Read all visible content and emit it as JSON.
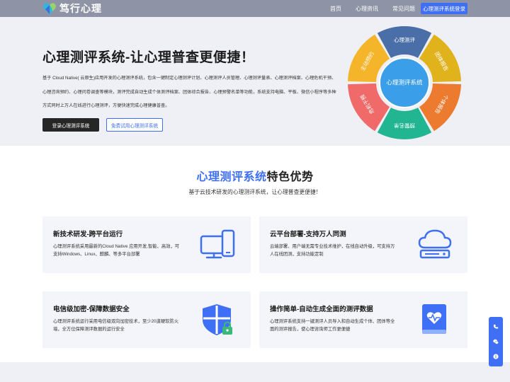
{
  "nav": {
    "brand": "笃行心理",
    "links": [
      "首页",
      "心理资讯",
      "常见问题"
    ],
    "login_button": "心理测评系统登录"
  },
  "hero": {
    "title": "心理测评系统-让心理普查更便捷！",
    "description": "基于 Cloud Native( 云原生)应用开发的心理测评系统，包含一键制定心理测评计划、心理测评人员管理、心理测评量表、心理测评档案、心理危机干预、心理咨询预约、心理问卷调查等模块，测评完成自动生成个体测评档案、团体综合报告、心理预警名单等功能，系统支持电脑、平板、微信小程序等多种方式同时上万人在线进行心理测评，方便快速完成心理健康普查。",
    "primary_button": "登录心理测评系统",
    "secondary_button": "免费试用心理测评系统",
    "wheel": {
      "center": "心理测评系统",
      "segments": [
        {
          "label": "心理测评",
          "color": "#4a6fa8"
        },
        {
          "label": "团体报告",
          "color": "#e0b21c"
        },
        {
          "label": "个体报告",
          "color": "#ec7b2f"
        },
        {
          "label": "预警名单",
          "color": "#22b592"
        },
        {
          "label": "危机干预",
          "color": "#f06a6a"
        },
        {
          "label": "主动预约",
          "color": "#f5b52a"
        }
      ]
    }
  },
  "features": {
    "title_highlight": "心理测评系统",
    "title_rest": "特色优势",
    "subtitle": "基于云技术研发的心理测评系统，让心理普查更便捷！",
    "cards": [
      {
        "title": "新技术研发-跨平台运行",
        "desc": "心理测评系统采用最新的Cloud Native 应用开发,智能、高效，可支持Windows、Linux、麒麟、等多平台部署",
        "icon": "devices-icon"
      },
      {
        "title": "云平台部署-支持万人同测",
        "desc": "云端部署、用户端无需专业技术维护，在线自动升级，可支持万人在线团测，支持功能定制",
        "icon": "cloud-server-icon"
      },
      {
        "title": "电信级加密-保障数据安全",
        "desc": "心理测评系统运行采用电信级双向加密技术，至少20道硬软防火墙，全方位保障测评数据的运行安全",
        "icon": "shield-lock-icon"
      },
      {
        "title": "操作简单-自动生成全面的测评数据",
        "desc": "心理测评系统支持一键测评人员导入和自动生成个体、团体等全面的测评报告，使心理咨询师工作更便捷",
        "icon": "health-book-icon"
      }
    ]
  },
  "side_bar": {
    "icons": [
      "phone-icon",
      "wechat-icon",
      "info-icon"
    ]
  },
  "colors": {
    "accent": "#3f6ff5",
    "nav_bg": "#8e94a6",
    "hero_bg": "#eef0f5"
  }
}
